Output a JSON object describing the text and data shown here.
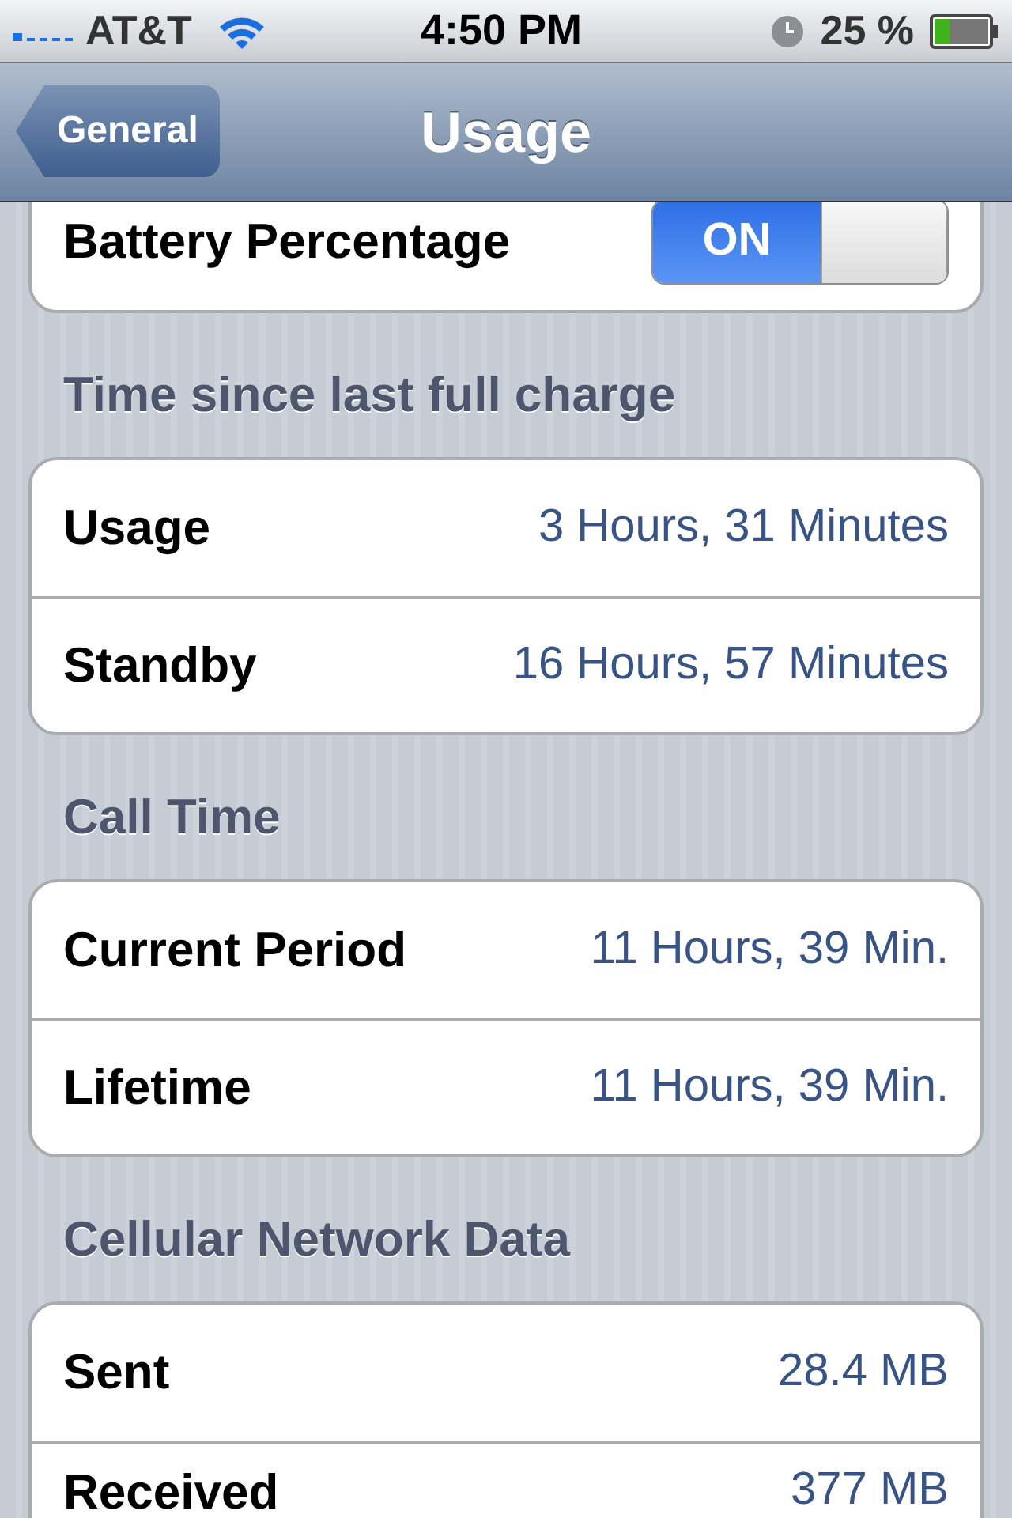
{
  "status_bar": {
    "carrier": "AT&T",
    "time": "4:50 PM",
    "battery_percent": "25 %"
  },
  "nav_bar": {
    "back_button": "General",
    "title": "Usage"
  },
  "sections": [
    {
      "rows": [
        {
          "kind": "toggle",
          "label": "Battery Percentage",
          "on": true,
          "toggle_text": "ON"
        }
      ]
    },
    {
      "header": "Time since last full charge",
      "rows": [
        {
          "kind": "value",
          "label": "Usage",
          "value": "3 Hours, 31 Minutes"
        },
        {
          "kind": "value",
          "label": "Standby",
          "value": "16 Hours, 57 Minutes"
        }
      ]
    },
    {
      "header": "Call Time",
      "rows": [
        {
          "kind": "value",
          "label": "Current Period",
          "value": "11 Hours, 39 Min."
        },
        {
          "kind": "value",
          "label": "Lifetime",
          "value": "11 Hours, 39 Min."
        }
      ]
    },
    {
      "header": "Cellular Network Data",
      "rows": [
        {
          "kind": "value",
          "label": "Sent",
          "value": "28.4 MB"
        },
        {
          "kind": "value",
          "label": "Received",
          "value": "377 MB"
        }
      ]
    }
  ]
}
